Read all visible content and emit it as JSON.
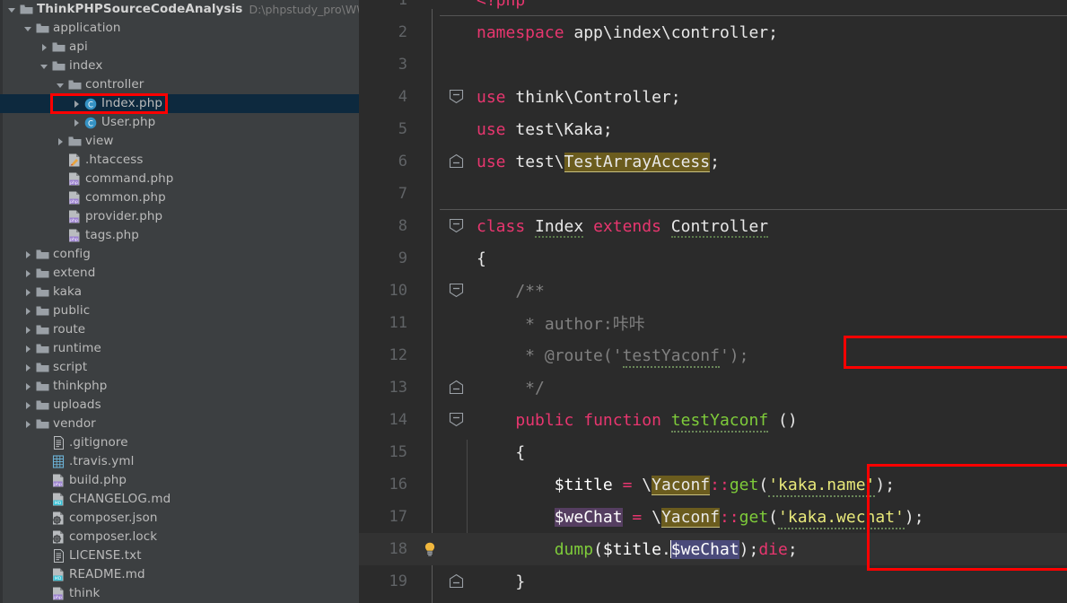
{
  "project": {
    "name": "ThinkPHPSourceCodeAnalysis",
    "path": "D:\\phpstudy_pro\\WWW\\Thin"
  },
  "sidebar": {
    "items": [
      {
        "label": "ThinkPHPSourceCodeAnalysis",
        "icon": "folder-icon",
        "arrow": "down",
        "indent": 0,
        "kind": "root",
        "path": "D:\\phpstudy_pro\\WWW\\Thin"
      },
      {
        "label": "application",
        "icon": "folder-icon",
        "arrow": "down",
        "indent": 1,
        "kind": "folder"
      },
      {
        "label": "api",
        "icon": "folder-icon",
        "arrow": "right",
        "indent": 2,
        "kind": "folder"
      },
      {
        "label": "index",
        "icon": "folder-icon",
        "arrow": "down",
        "indent": 2,
        "kind": "folder"
      },
      {
        "label": "controller",
        "icon": "folder-icon",
        "arrow": "down",
        "indent": 3,
        "kind": "folder"
      },
      {
        "label": "Index.php",
        "icon": "php-class-icon",
        "arrow": "right",
        "indent": 4,
        "kind": "class",
        "selected": true
      },
      {
        "label": "User.php",
        "icon": "php-class-icon",
        "arrow": "right",
        "indent": 4,
        "kind": "class"
      },
      {
        "label": "view",
        "icon": "folder-icon",
        "arrow": "right",
        "indent": 3,
        "kind": "folder"
      },
      {
        "label": ".htaccess",
        "icon": "htaccess-icon",
        "arrow": "none",
        "indent": 3,
        "kind": "file"
      },
      {
        "label": "command.php",
        "icon": "php-file-icon",
        "arrow": "none",
        "indent": 3,
        "kind": "file"
      },
      {
        "label": "common.php",
        "icon": "php-file-icon",
        "arrow": "none",
        "indent": 3,
        "kind": "file"
      },
      {
        "label": "provider.php",
        "icon": "php-file-icon",
        "arrow": "none",
        "indent": 3,
        "kind": "file"
      },
      {
        "label": "tags.php",
        "icon": "php-file-icon",
        "arrow": "none",
        "indent": 3,
        "kind": "file"
      },
      {
        "label": "config",
        "icon": "folder-icon",
        "arrow": "right",
        "indent": 1,
        "kind": "folder"
      },
      {
        "label": "extend",
        "icon": "folder-icon",
        "arrow": "right",
        "indent": 1,
        "kind": "folder"
      },
      {
        "label": "kaka",
        "icon": "folder-icon",
        "arrow": "right",
        "indent": 1,
        "kind": "folder"
      },
      {
        "label": "public",
        "icon": "folder-icon",
        "arrow": "right",
        "indent": 1,
        "kind": "folder"
      },
      {
        "label": "route",
        "icon": "folder-icon",
        "arrow": "right",
        "indent": 1,
        "kind": "folder"
      },
      {
        "label": "runtime",
        "icon": "folder-icon",
        "arrow": "right",
        "indent": 1,
        "kind": "folder"
      },
      {
        "label": "script",
        "icon": "folder-icon",
        "arrow": "right",
        "indent": 1,
        "kind": "folder"
      },
      {
        "label": "thinkphp",
        "icon": "folder-icon",
        "arrow": "right",
        "indent": 1,
        "kind": "folder"
      },
      {
        "label": "uploads",
        "icon": "folder-icon",
        "arrow": "right",
        "indent": 1,
        "kind": "folder"
      },
      {
        "label": "vendor",
        "icon": "folder-icon",
        "arrow": "right",
        "indent": 1,
        "kind": "folder"
      },
      {
        "label": ".gitignore",
        "icon": "text-file-icon",
        "arrow": "none",
        "indent": 2,
        "kind": "file"
      },
      {
        "label": ".travis.yml",
        "icon": "yml-file-icon",
        "arrow": "none",
        "indent": 2,
        "kind": "file"
      },
      {
        "label": "build.php",
        "icon": "php-file-icon",
        "arrow": "none",
        "indent": 2,
        "kind": "file"
      },
      {
        "label": "CHANGELOG.md",
        "icon": "md-file-icon",
        "arrow": "none",
        "indent": 2,
        "kind": "file"
      },
      {
        "label": "composer.json",
        "icon": "composer-icon",
        "arrow": "none",
        "indent": 2,
        "kind": "file"
      },
      {
        "label": "composer.lock",
        "icon": "composer-icon",
        "arrow": "none",
        "indent": 2,
        "kind": "file"
      },
      {
        "label": "LICENSE.txt",
        "icon": "text-file-icon",
        "arrow": "none",
        "indent": 2,
        "kind": "file"
      },
      {
        "label": "README.md",
        "icon": "md-file-icon",
        "arrow": "none",
        "indent": 2,
        "kind": "file"
      },
      {
        "label": "think",
        "icon": "php-file-icon",
        "arrow": "none",
        "indent": 2,
        "kind": "file"
      }
    ]
  },
  "editor": {
    "language": "PHP",
    "current_line": 18,
    "lines": [
      {
        "n": "1",
        "text": "<?php"
      },
      {
        "n": "2",
        "text": "namespace app\\index\\controller;"
      },
      {
        "n": "3",
        "text": ""
      },
      {
        "n": "4",
        "text": "use think\\Controller;"
      },
      {
        "n": "5",
        "text": "use test\\Kaka;"
      },
      {
        "n": "6",
        "text": "use test\\TestArrayAccess;"
      },
      {
        "n": "7",
        "text": ""
      },
      {
        "n": "8",
        "text": "class Index extends Controller"
      },
      {
        "n": "9",
        "text": "{"
      },
      {
        "n": "10",
        "text": "    /**"
      },
      {
        "n": "11",
        "text": "     * author:咔咔"
      },
      {
        "n": "12",
        "text": "     * @route('testYaconf');"
      },
      {
        "n": "13",
        "text": "     */"
      },
      {
        "n": "14",
        "text": "    public function testYaconf ()"
      },
      {
        "n": "15",
        "text": "    {"
      },
      {
        "n": "16",
        "text": "        $title = \\Yaconf::get('kaka.name');"
      },
      {
        "n": "17",
        "text": "        $weChat = \\Yaconf::get('kaka.wechat');"
      },
      {
        "n": "18",
        "text": "        dump($title.$weChat);die;"
      },
      {
        "n": "19",
        "text": "    }"
      }
    ],
    "gutter_icons": [
      {
        "line": "18",
        "icon": "lightbulb-icon"
      }
    ]
  },
  "annotations": [
    {
      "name": "annotation-index-php",
      "color": "#ff0000",
      "target": "Index.php"
    },
    {
      "name": "annotation-route-comment",
      "color": "#ff0000",
      "target": "line 12 @route('testYaconf');"
    },
    {
      "name": "annotation-yaconf-block",
      "color": "#ff0000",
      "target": "lines 16-18"
    }
  ],
  "colors": {
    "sidebar_bg": "#3c3f41",
    "editor_bg": "#2b2b2b",
    "selection_bg": "#0d293e",
    "current_line_bg": "#323232",
    "annotation": "#ff0000",
    "keyword": "#e8366f",
    "string": "#e8e87a",
    "comment": "#808080",
    "function": "#7ecb3a",
    "highlight_yaconf": "#6b5c1e",
    "highlight_wechat_purple": "#553e61",
    "highlight_wechat_blue": "#4a4a7a"
  }
}
